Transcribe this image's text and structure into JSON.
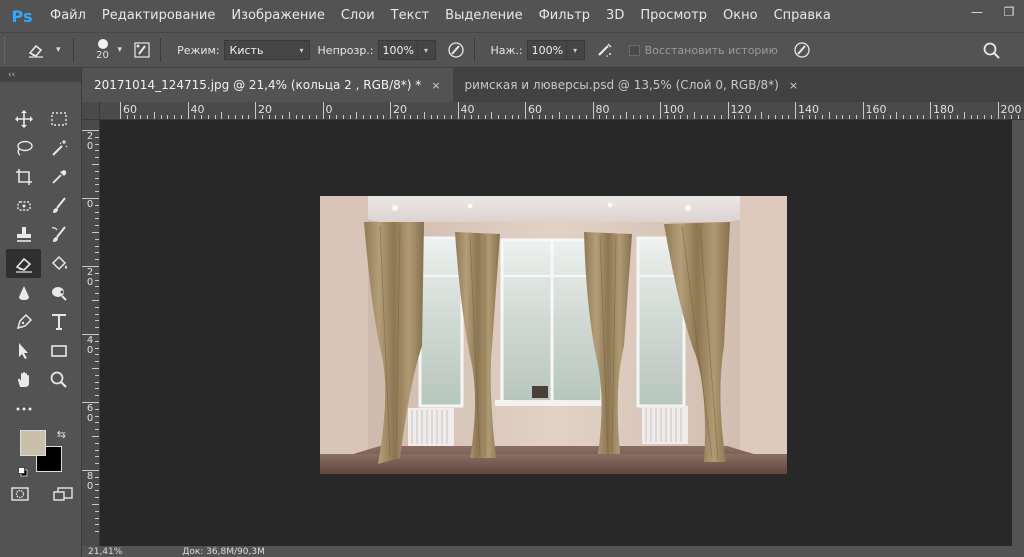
{
  "app": {
    "logo": "Ps"
  },
  "menu": [
    "Файл",
    "Редактирование",
    "Изображение",
    "Слои",
    "Текст",
    "Выделение",
    "Фильтр",
    "3D",
    "Просмотр",
    "Окно",
    "Справка"
  ],
  "window": {
    "minimize": "—",
    "restore": "❐"
  },
  "options": {
    "brush_size": "20",
    "mode_label": "Режим:",
    "mode_value": "Кисть",
    "opacity_label": "Непрозр.:",
    "opacity_value": "100%",
    "flow_label": "Наж.:",
    "flow_value": "100%",
    "restore_history": "Восстановить историю"
  },
  "toolbar": {
    "collapse": "‹‹"
  },
  "tabs": [
    {
      "label": "20171014_124715.jpg @ 21,4% (кольца 2 , RGB/8*) *",
      "close": "×"
    },
    {
      "label": "римская и люверсы.psd @ 13,5% (Слой 0, RGB/8*)",
      "close": "×"
    }
  ],
  "ruler_h": [
    "60",
    "40",
    "20",
    "0",
    "20",
    "40",
    "60",
    "80",
    "100",
    "120",
    "140",
    "160",
    "180",
    "200"
  ],
  "ruler_v": [
    "2 0",
    "0",
    "2 0",
    "4 0",
    "6 0",
    "8 0"
  ],
  "status": {
    "zoom": "21,41%",
    "doc": "Док: 36,8M/90,3M"
  },
  "colors": {
    "foreground": "#c9c0aa",
    "background": "#000000",
    "canvas": "#282828",
    "ui": "#535353",
    "accent": "#31a8ff"
  }
}
